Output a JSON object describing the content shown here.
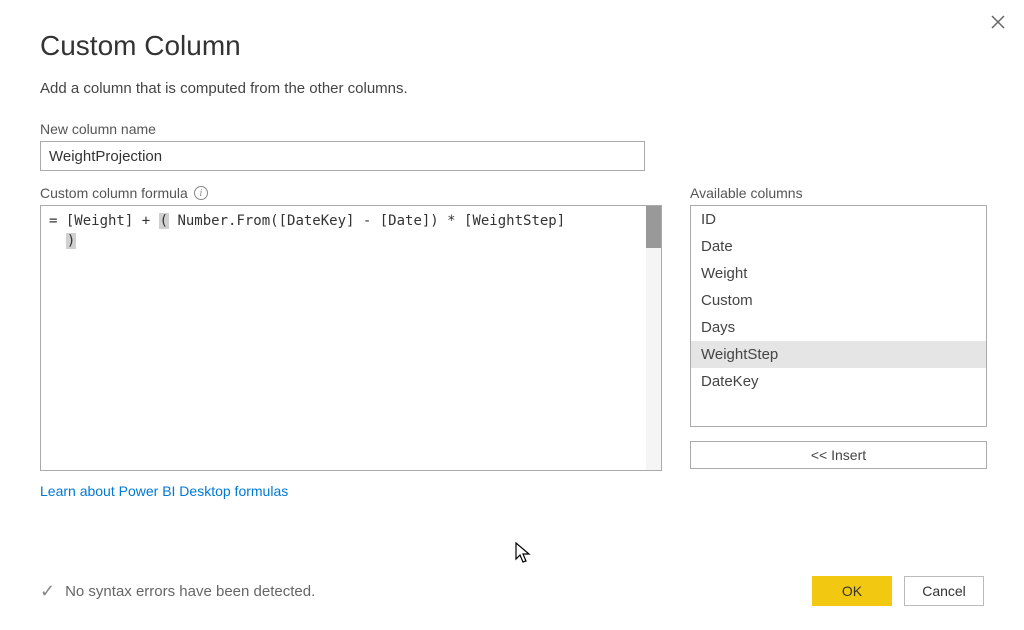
{
  "dialog": {
    "title": "Custom Column",
    "subtitle": "Add a column that is computed from the other columns.",
    "close_tooltip": "Close"
  },
  "name_field": {
    "label": "New column name",
    "value": "WeightProjection"
  },
  "formula_field": {
    "label": "Custom column formula",
    "prefix": "= ",
    "segments": {
      "a": "[Weight] + ",
      "open_paren": "(",
      "b": " Number.From([DateKey] - [Date]) * [WeightStep]",
      "close_paren": ")"
    }
  },
  "columns": {
    "label": "Available columns",
    "items": [
      "ID",
      "Date",
      "Weight",
      "Custom",
      "Days",
      "WeightStep",
      "DateKey"
    ],
    "selected_index": 5,
    "insert_label": "<< Insert"
  },
  "link": {
    "label": "Learn about Power BI Desktop formulas"
  },
  "status": {
    "message": "No syntax errors have been detected."
  },
  "buttons": {
    "ok": "OK",
    "cancel": "Cancel"
  }
}
